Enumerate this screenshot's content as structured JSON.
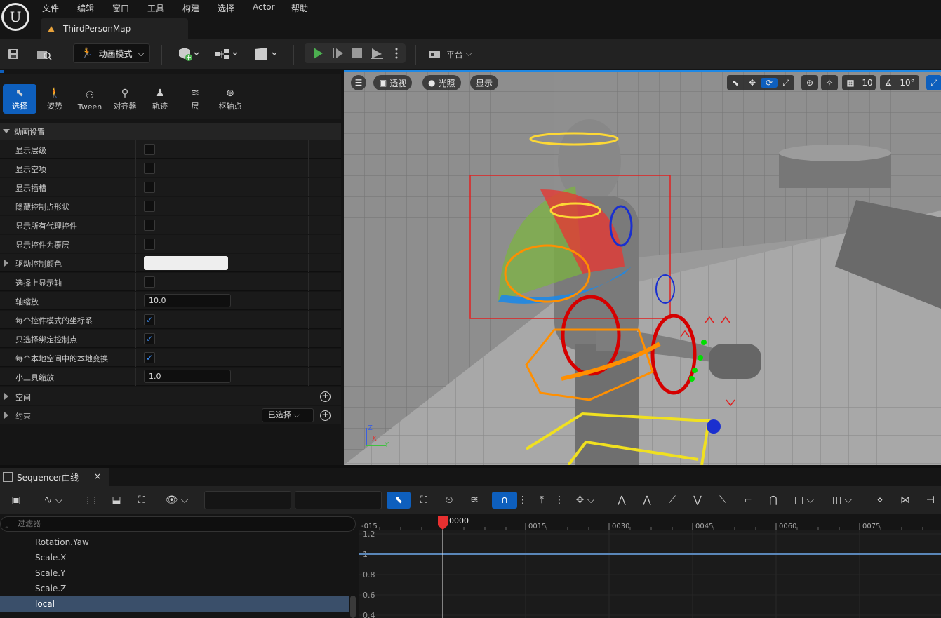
{
  "menu": [
    "文件",
    "编辑",
    "窗口",
    "工具",
    "构建",
    "选择",
    "Actor",
    "帮助"
  ],
  "map_tab": "ThirdPersonMap",
  "toolbar": {
    "mode_label": "动画模式",
    "platform_label": "平台"
  },
  "mode_tabs": [
    {
      "label": "选择",
      "icon": "select-icon",
      "selected": true
    },
    {
      "label": "姿势",
      "icon": "pose-icon"
    },
    {
      "label": "Tween",
      "icon": "tween-icon"
    },
    {
      "label": "对齐器",
      "icon": "aligner-icon"
    },
    {
      "label": "轨迹",
      "icon": "trail-icon"
    },
    {
      "label": "层",
      "icon": "layer-icon"
    },
    {
      "label": "枢轴点",
      "icon": "pivot-icon"
    }
  ],
  "section_title": "动画设置",
  "props": [
    {
      "label": "显示层级",
      "type": "check",
      "checked": false
    },
    {
      "label": "显示空项",
      "type": "check",
      "checked": false
    },
    {
      "label": "显示插槽",
      "type": "check",
      "checked": false
    },
    {
      "label": "隐藏控制点形状",
      "type": "check",
      "checked": false
    },
    {
      "label": "显示所有代理控件",
      "type": "check",
      "checked": false
    },
    {
      "label": "显示控件为覆层",
      "type": "check",
      "checked": false
    },
    {
      "label": "驱动控制颜色",
      "type": "color",
      "color": "#eeeeee"
    },
    {
      "label": "选择上显示轴",
      "type": "check",
      "checked": false
    },
    {
      "label": "轴缩放",
      "type": "num",
      "value": "10.0"
    },
    {
      "label": "每个控件模式的坐标系",
      "type": "check",
      "checked": true
    },
    {
      "label": "只选择绑定控制点",
      "type": "check",
      "checked": true
    },
    {
      "label": "每个本地空间中的本地变换",
      "type": "check",
      "checked": true
    },
    {
      "label": "小工具缩放",
      "type": "num",
      "value": "1.0"
    }
  ],
  "groups": {
    "space": "空间",
    "constraint": "约束",
    "constraint_dropdown": "已选择"
  },
  "viewport": {
    "perspective": "透视",
    "lit": "光照",
    "show": "显示",
    "grid_snap": "10",
    "rot_snap": "10°"
  },
  "sequencer": {
    "tab_label": "Sequencer曲线",
    "filter_placeholder": "过滤器",
    "tree": [
      "Rotation.Yaw",
      "Scale.X",
      "Scale.Y",
      "Scale.Z",
      "local"
    ],
    "selected_index": 4,
    "frames": [
      "-015",
      "0000",
      "0015",
      "0030",
      "0045",
      "0060",
      "0075"
    ],
    "current_frame": "0000",
    "y_labels": [
      "1.2",
      "1",
      "0.8",
      "0.6",
      "0.4"
    ]
  },
  "colors": {
    "accent": "#0e5fbd",
    "play": "#4caf50",
    "playhead": "#e83030"
  }
}
